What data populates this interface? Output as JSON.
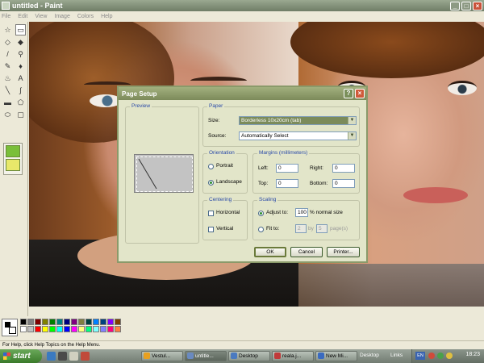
{
  "window": {
    "title": "untitled - Paint",
    "minimize": "_",
    "maximize": "□",
    "close": "×"
  },
  "menu": [
    "File",
    "Edit",
    "View",
    "Image",
    "Colors",
    "Help"
  ],
  "tools": [
    {
      "name": "free-form-select-icon",
      "glyph": "☆"
    },
    {
      "name": "select-icon",
      "glyph": "▭"
    },
    {
      "name": "eraser-icon",
      "glyph": "◇"
    },
    {
      "name": "fill-icon",
      "glyph": "◆"
    },
    {
      "name": "pick-color-icon",
      "glyph": "/"
    },
    {
      "name": "magnifier-icon",
      "glyph": "⚲"
    },
    {
      "name": "pencil-icon",
      "glyph": "✎"
    },
    {
      "name": "brush-icon",
      "glyph": "♦"
    },
    {
      "name": "airbrush-icon",
      "glyph": "♨"
    },
    {
      "name": "text-icon",
      "glyph": "A"
    },
    {
      "name": "line-icon",
      "glyph": "╲"
    },
    {
      "name": "curve-icon",
      "glyph": "∫"
    },
    {
      "name": "rectangle-icon",
      "glyph": "▬"
    },
    {
      "name": "polygon-icon",
      "glyph": "⬠"
    },
    {
      "name": "ellipse-icon",
      "glyph": "⬭"
    },
    {
      "name": "rounded-rect-icon",
      "glyph": "▢"
    }
  ],
  "dialog": {
    "title": "Page Setup",
    "help": "?",
    "close": "×",
    "preview_label": "Preview",
    "paper": {
      "label": "Paper",
      "size_label": "Size:",
      "size_value": "Borderless 10x20cm (tab)",
      "source_label": "Source:",
      "source_value": "Automatically Select"
    },
    "orientation": {
      "label": "Orientation",
      "portrait": "Portrait",
      "landscape": "Landscape",
      "selected": "landscape"
    },
    "margins": {
      "label": "Margins (millimeters)",
      "left_label": "Left:",
      "left": "0",
      "right_label": "Right:",
      "right": "0",
      "top_label": "Top:",
      "top": "0",
      "bottom_label": "Bottom:",
      "bottom": "0"
    },
    "centering": {
      "label": "Centering",
      "horizontal": "Horizontal",
      "vertical": "Vertical"
    },
    "scaling": {
      "label": "Scaling",
      "adjust_label": "Adjust to:",
      "adjust_value": "100",
      "adjust_suffix": "% normal size",
      "fit_label": "Fit to:",
      "fit_wide": "2",
      "fit_by": "by",
      "fit_tall": "5",
      "fit_suffix": "page(s)"
    },
    "buttons": {
      "ok": "OK",
      "cancel": "Cancel",
      "printer": "Printer..."
    }
  },
  "palette": {
    "fg": "#000000",
    "bg": "#ffffff",
    "colors": [
      "#000000",
      "#808080",
      "#800000",
      "#808000",
      "#008000",
      "#008080",
      "#000080",
      "#800080",
      "#808040",
      "#004040",
      "#0080ff",
      "#004080",
      "#8000ff",
      "#804000",
      "#ffffff",
      "#c0c0c0",
      "#ff0000",
      "#ffff00",
      "#00ff00",
      "#00ffff",
      "#0000ff",
      "#ff00ff",
      "#ffff80",
      "#00ff80",
      "#80ffff",
      "#8080ff",
      "#ff0080",
      "#ff8040"
    ]
  },
  "status": "For Help, click Help Topics on the Help Menu.",
  "taskbar": {
    "start": "start",
    "tasks": [
      {
        "label": "Vestul...",
        "color": "#e8a020",
        "active": false
      },
      {
        "label": "untitle...",
        "color": "#6a8ac0",
        "active": true
      },
      {
        "label": "Desktop",
        "color": "#4a7ac0",
        "active": false
      },
      {
        "label": "reala.j...",
        "color": "#c03a3a",
        "active": false
      },
      {
        "label": "New Mi...",
        "color": "#3a6ac0",
        "active": false
      }
    ],
    "desktop": "Desktop",
    "links": "Links",
    "lang": "EN",
    "clock": "18:23"
  }
}
